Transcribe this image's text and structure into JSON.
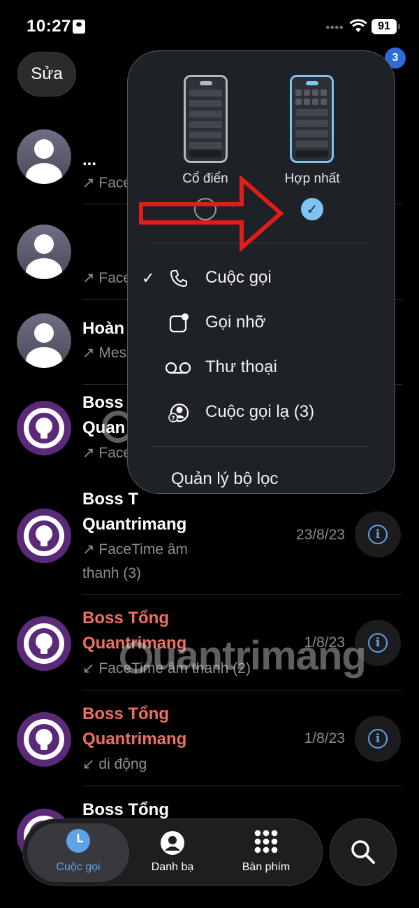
{
  "status_bar": {
    "time": "10:27",
    "battery": "91"
  },
  "header": {
    "edit_label": "Sửa",
    "badge_count": "3"
  },
  "calls": [
    {
      "name": "...",
      "detail": "↗ Face",
      "date": "",
      "avatar": "person",
      "missed": false
    },
    {
      "name": "",
      "detail": "↗ Face",
      "date": "",
      "avatar": "person",
      "missed": false
    },
    {
      "name": "Hoàn",
      "detail": "↗ Mes",
      "date": "",
      "avatar": "person",
      "missed": false
    },
    {
      "name_line1": "Boss",
      "name_line2": "Quan",
      "detail": "↗ Face",
      "date": "",
      "avatar": "bulb",
      "missed": false
    },
    {
      "name_line1": "Boss T",
      "name_line2": "Quantrimang",
      "detail_line1": "↗ FaceTime âm",
      "detail_line2": "thanh (3)",
      "date": "23/8/23",
      "avatar": "bulb",
      "missed": false
    },
    {
      "name_line1": "Boss Tổng",
      "name_line2": "Quantrimang",
      "detail": "↙ FaceTime âm thanh (2)",
      "date": "1/8/23",
      "avatar": "bulb",
      "missed": true
    },
    {
      "name_line1": "Boss Tổng",
      "name_line2": "Quantrimang",
      "detail": "↙ di động",
      "date": "1/8/23",
      "avatar": "bulb",
      "missed": true
    },
    {
      "name_line1": "Boss Tổng",
      "avatar": "bulb",
      "missed": false
    }
  ],
  "popup": {
    "view_classic": "Cổ điển",
    "view_unified": "Hợp nhất",
    "selected_view": "unified",
    "menu": [
      {
        "label": "Cuộc gọi",
        "icon": "phone-icon",
        "checked": true
      },
      {
        "label": "Gọi nhỡ",
        "icon": "missed-call-icon",
        "checked": false
      },
      {
        "label": "Thư thoại",
        "icon": "voicemail-icon",
        "checked": false
      },
      {
        "label": "Cuộc gọi lạ (3)",
        "icon": "unknown-caller-icon",
        "checked": false
      }
    ],
    "manage_filters": "Quản lý bộ lọc"
  },
  "watermark": "uantrimang",
  "tabs": [
    {
      "label": "Cuộc gọi",
      "icon": "clock-icon",
      "active": true
    },
    {
      "label": "Danh bạ",
      "icon": "contact-icon",
      "active": false
    },
    {
      "label": "Bàn phím",
      "icon": "keypad-icon",
      "active": false
    }
  ],
  "colors": {
    "accent": "#5fa3e6",
    "missed": "#ef6f63",
    "arrow": "#e21b1b"
  }
}
